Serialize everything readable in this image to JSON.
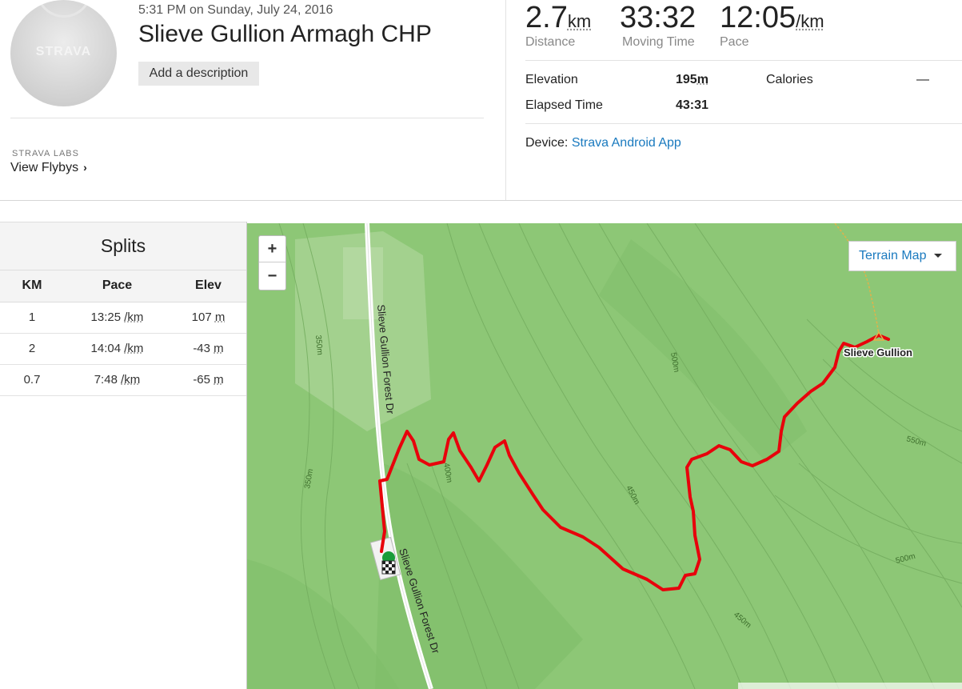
{
  "activity": {
    "avatar_brand": "STRAVA",
    "datetime": "5:31 PM on Sunday, July 24, 2016",
    "title": "Slieve Gullion Armagh CHP",
    "add_description": "Add a description"
  },
  "labs": {
    "label": "STRAVA LABS",
    "flybys": "View Flybys",
    "chevron": "›"
  },
  "stats": {
    "distance": {
      "value": "2.7",
      "unit": "km",
      "label": "Distance"
    },
    "moving_time": {
      "value": "33:32",
      "label": "Moving Time"
    },
    "pace": {
      "value": "12:05",
      "unit": "/km",
      "label": "Pace"
    },
    "elevation": {
      "label": "Elevation",
      "value": "195",
      "unit": "m"
    },
    "calories": {
      "label": "Calories",
      "value": "—"
    },
    "elapsed": {
      "label": "Elapsed Time",
      "value": "43:31"
    },
    "device_label": "Device:",
    "device_value": "Strava Android App"
  },
  "splits": {
    "title": "Splits",
    "columns": [
      "KM",
      "Pace",
      "Elev"
    ],
    "rows": [
      {
        "km": "1",
        "pace": "13:25",
        "pace_unit": "/km",
        "elev": "107",
        "elev_unit": "m"
      },
      {
        "km": "2",
        "pace": "14:04",
        "pace_unit": "/km",
        "elev": "-43",
        "elev_unit": "m"
      },
      {
        "km": "0.7",
        "pace": "7:48",
        "pace_unit": "/km",
        "elev": "-65",
        "elev_unit": "m"
      }
    ]
  },
  "map": {
    "zoom_in": "+",
    "zoom_out": "−",
    "type_button": "Terrain Map",
    "road_name": "Slieve Gullion Forest Dr",
    "peak_name": "Slieve Gullion",
    "contours": [
      "350m",
      "350m",
      "400m",
      "450m",
      "450m",
      "500m",
      "500m",
      "550m"
    ],
    "route_color": "#e8000b",
    "terrain_color": "#8dc776"
  }
}
